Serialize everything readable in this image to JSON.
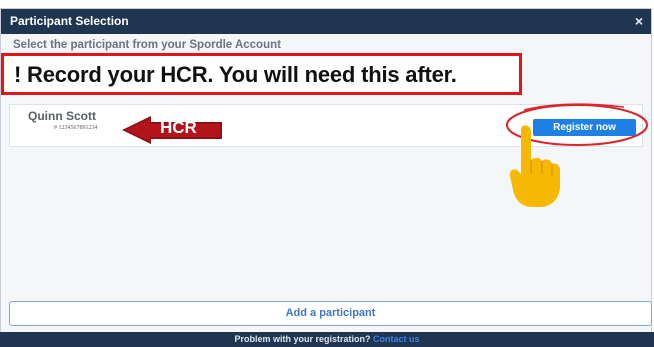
{
  "dialog": {
    "title": "Participant Selection",
    "close_glyph": "×",
    "subtitle": "Select the participant from your Spordle Account"
  },
  "notice": {
    "text": "! Record your HCR. You will need this after."
  },
  "participant": {
    "name": "Quinn Scott",
    "hcr_number": "# 1234567891234",
    "register_label": "Register now"
  },
  "annotations": {
    "hcr_label": "HCR",
    "arrow_color": "#b3141b",
    "circle_color": "#d9262c",
    "hand_color": "#f6b800"
  },
  "actions": {
    "add_participant_label": "Add a participant"
  },
  "footer": {
    "text": "Problem with your registration?",
    "link": "Contact us"
  }
}
